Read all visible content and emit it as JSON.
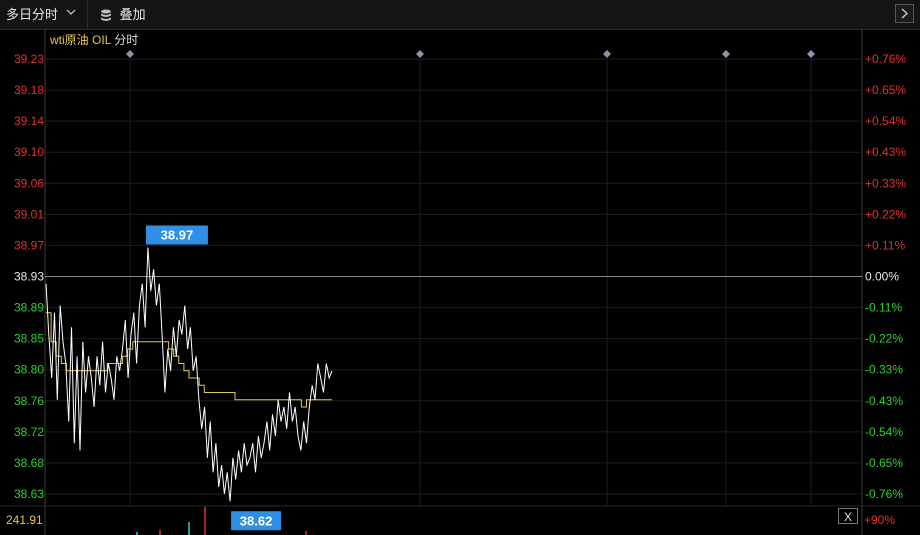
{
  "toolbar": {
    "period_label": "多日分时",
    "overlay_label": "叠加",
    "period_icon": "chevron-down-icon",
    "overlay_icon": "database-icon",
    "next_icon": "chevron-right-icon"
  },
  "chart": {
    "title_symbol": "wti原油 OIL",
    "title_mode": "分时",
    "close_label": "X"
  },
  "colors": {
    "background": "#000000",
    "price_line": "#ffffff",
    "avg_line": "#e6c84a",
    "up": "#e0312f",
    "down": "#2bd12b",
    "base_axis": "#e6e6e6",
    "marker_bg": "#2f8fe5",
    "grid": "#1e1e1e",
    "day_marker": "#8796ad"
  },
  "chart_data": {
    "type": "line",
    "base_price": 38.93,
    "y_ticks": [
      "39.23",
      "39.18",
      "39.14",
      "39.10",
      "39.06",
      "39.01",
      "38.97",
      "38.93",
      "38.89",
      "38.85",
      "38.80",
      "38.76",
      "38.72",
      "38.68",
      "38.63"
    ],
    "pct_ticks": [
      "+0.76%",
      "+0.65%",
      "+0.54%",
      "+0.43%",
      "+0.33%",
      "+0.22%",
      "+0.11%",
      "0.00%",
      "-0.11%",
      "-0.22%",
      "-0.33%",
      "-0.43%",
      "-0.54%",
      "-0.65%",
      "-0.76%"
    ],
    "ylim": [
      38.63,
      39.23
    ],
    "high_label": "38.97",
    "low_label": "38.62",
    "volume_max_label": "241.91",
    "volume_pct_label": "+90%",
    "day_markers": 5,
    "series": [
      {
        "values": [
          38.92,
          38.85,
          38.79,
          38.88,
          38.76,
          38.89,
          38.84,
          38.81,
          38.73,
          38.86,
          38.7,
          38.82,
          38.69,
          38.84,
          38.77,
          38.82,
          38.79,
          38.75,
          38.82,
          38.78,
          38.84,
          38.77,
          38.81,
          38.79,
          38.76,
          38.82,
          38.8,
          38.83,
          38.87,
          38.79,
          38.85,
          38.88,
          38.81,
          38.89,
          38.92,
          38.86,
          38.97,
          38.91,
          38.94,
          38.89,
          38.92,
          38.85,
          38.77,
          38.83,
          38.8,
          38.86,
          38.82,
          38.87,
          38.85,
          38.89,
          38.83,
          38.86,
          38.8,
          38.82,
          38.76,
          38.72,
          38.75,
          38.68,
          38.73,
          38.66,
          38.7,
          38.64,
          38.67,
          38.63,
          38.66,
          38.62,
          38.68,
          38.65,
          38.69,
          38.66,
          38.7,
          38.67,
          38.68,
          38.7,
          38.66,
          38.71,
          38.68,
          38.7,
          38.73,
          38.69,
          38.74,
          38.71,
          38.76,
          38.73,
          38.75,
          38.72,
          38.77,
          38.73,
          38.75,
          38.71,
          38.69,
          38.73,
          38.7,
          38.75,
          38.78,
          38.76,
          38.81,
          38.79,
          38.77,
          38.81,
          38.79,
          38.8
        ]
      },
      {
        "values": [
          38.88,
          38.84,
          38.82,
          38.81,
          38.8,
          38.8,
          38.8,
          38.8,
          38.8,
          38.8,
          38.8,
          38.8,
          38.81,
          38.81,
          38.81,
          38.82,
          38.83,
          38.84,
          38.84,
          38.84,
          38.84,
          38.84,
          38.84,
          38.84,
          38.83,
          38.82,
          38.81,
          38.8,
          38.79,
          38.79,
          38.78,
          38.77,
          38.77,
          38.77,
          38.77,
          38.77,
          38.77,
          38.76,
          38.76,
          38.76,
          38.76,
          38.76,
          38.76,
          38.76,
          38.76,
          38.76,
          38.76,
          38.76,
          38.76,
          38.76,
          38.75,
          38.76,
          38.76,
          38.76,
          38.76,
          38.76,
          38.76
        ]
      }
    ]
  }
}
